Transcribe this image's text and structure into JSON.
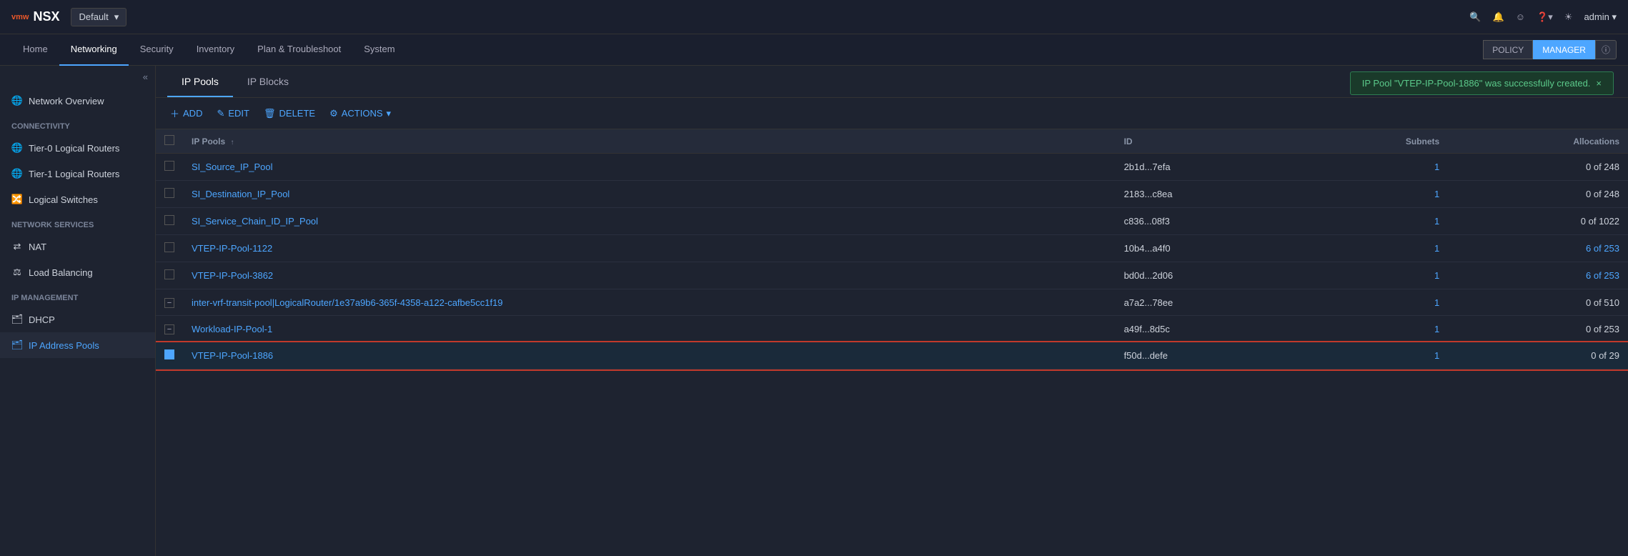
{
  "app": {
    "logo": "vmw",
    "title": "NSX",
    "env": "Default"
  },
  "topbar": {
    "icons": {
      "search": "🔍",
      "bell": "🔔",
      "face": "☺",
      "help": "?",
      "sun": "☀",
      "admin": "admin",
      "chevron": "▾"
    }
  },
  "nav": {
    "items": [
      "Home",
      "Networking",
      "Security",
      "Inventory",
      "Plan & Troubleshoot",
      "System"
    ],
    "active": "Networking"
  },
  "mode_buttons": {
    "policy": "POLICY",
    "manager": "MANAGER",
    "info": "ⓘ"
  },
  "sidebar": {
    "collapse_icon": "«",
    "network_overview": "Network Overview",
    "section_connectivity": "Connectivity",
    "items_connectivity": [
      {
        "label": "Tier-0 Logical Routers",
        "icon": "🌐"
      },
      {
        "label": "Tier-1 Logical Routers",
        "icon": "🌐"
      },
      {
        "label": "Logical Switches",
        "icon": "🔀"
      }
    ],
    "section_network_services": "Network Services",
    "items_network_services": [
      {
        "label": "NAT",
        "icon": "⇄"
      },
      {
        "label": "Load Balancing",
        "icon": "⚖"
      }
    ],
    "section_ip_management": "IP Management",
    "items_ip_management": [
      {
        "label": "DHCP",
        "icon": "🗂"
      },
      {
        "label": "IP Address Pools",
        "icon": "🗂",
        "active": true
      }
    ]
  },
  "tabs": {
    "items": [
      "IP Pools",
      "IP Blocks"
    ],
    "active": "IP Pools"
  },
  "notification": {
    "message": "IP Pool \"VTEP-IP-Pool-1886\" was successfully created.",
    "close": "×"
  },
  "toolbar": {
    "add": "+ ADD",
    "edit": "✎ EDIT",
    "delete": "🗑 DELETE",
    "actions": "⚙ ACTIONS ▾"
  },
  "table": {
    "columns": [
      {
        "label": "IP Pools",
        "sortable": true
      },
      {
        "label": "ID"
      },
      {
        "label": "Subnets",
        "align": "right"
      },
      {
        "label": "Allocations",
        "align": "right"
      }
    ],
    "rows": [
      {
        "name": "SI_Source_IP_Pool",
        "id": "2b1d...7efa",
        "subnets": "1",
        "allocations": "0 of 248",
        "selected": false,
        "minus": false,
        "highlight": false
      },
      {
        "name": "SI_Destination_IP_Pool",
        "id": "2183...c8ea",
        "subnets": "1",
        "allocations": "0 of 248",
        "selected": false,
        "minus": false,
        "highlight": false
      },
      {
        "name": "SI_Service_Chain_ID_IP_Pool",
        "id": "c836...08f3",
        "subnets": "1",
        "allocations": "0 of 1022",
        "selected": false,
        "minus": false,
        "highlight": false
      },
      {
        "name": "VTEP-IP-Pool-1122",
        "id": "10b4...a4f0",
        "subnets": "1",
        "allocations": "6 of 253",
        "allocations_link": true,
        "selected": false,
        "minus": false,
        "highlight": false
      },
      {
        "name": "VTEP-IP-Pool-3862",
        "id": "bd0d...2d06",
        "subnets": "1",
        "allocations": "6 of 253",
        "allocations_link": true,
        "selected": false,
        "minus": false,
        "highlight": false
      },
      {
        "name": "inter-vrf-transit-pool|LogicalRouter/1e37a9b6-365f-4358-a122-cafbe5cc1f19",
        "id": "a7a2...78ee",
        "subnets": "1",
        "allocations": "0 of 510",
        "selected": false,
        "minus": true,
        "highlight": false
      },
      {
        "name": "Workload-IP-Pool-1",
        "id": "a49f...8d5c",
        "subnets": "1",
        "allocations": "0 of 253",
        "selected": false,
        "minus": true,
        "highlight": false
      },
      {
        "name": "VTEP-IP-Pool-1886",
        "id": "f50d...defe",
        "subnets": "1",
        "allocations": "0 of 29",
        "selected": true,
        "minus": false,
        "highlight": true
      }
    ]
  }
}
